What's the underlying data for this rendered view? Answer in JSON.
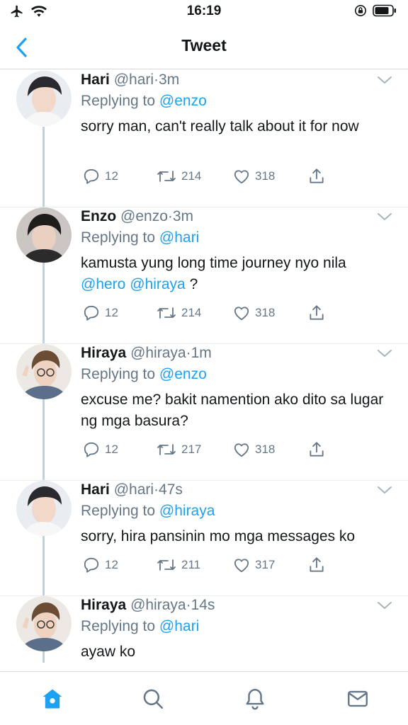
{
  "status_bar": {
    "time": "16:19"
  },
  "nav": {
    "title": "Tweet"
  },
  "colors": {
    "accent": "#1da1f2",
    "secondary_text": "#657786",
    "primary_text": "#14171a"
  },
  "tweets": [
    {
      "name": "Hari",
      "handle": "@hari",
      "dot": "·",
      "time": "3m",
      "replying_label": "Replying to",
      "replying_to": "@enzo",
      "body": "sorry man, can't really talk about it for now",
      "mentions": "",
      "replies": "12",
      "retweets": "214",
      "likes": "318"
    },
    {
      "name": "Enzo",
      "handle": "@enzo",
      "dot": "·",
      "time": "3m",
      "replying_label": "Replying to",
      "replying_to": "@hari",
      "body": "kamusta yung long time journey nyo nila",
      "mentions": [
        "@hero",
        "@hiraya",
        "?"
      ],
      "replies": "12",
      "retweets": "214",
      "likes": "318"
    },
    {
      "name": "Hiraya",
      "handle": "@hiraya",
      "dot": "·",
      "time": "1m",
      "replying_label": "Replying to",
      "replying_to": "@enzo",
      "body": "excuse me? bakit namention ako dito sa lugar ng mga basura?",
      "mentions": "",
      "replies": "12",
      "retweets": "217",
      "likes": "318"
    },
    {
      "name": "Hari",
      "handle": "@hari",
      "dot": "·",
      "time": "47s",
      "replying_label": "Replying to",
      "replying_to": "@hiraya",
      "body": "sorry, hira pansinin mo mga messages ko",
      "mentions": "",
      "replies": "12",
      "retweets": "211",
      "likes": "317"
    },
    {
      "name": "Hiraya",
      "handle": "@hiraya",
      "dot": "·",
      "time": "14s",
      "replying_label": "Replying to",
      "replying_to": "@hari",
      "body": "ayaw ko",
      "mentions": "",
      "replies": "",
      "retweets": "",
      "likes": ""
    }
  ],
  "tab_bar": {
    "icons": [
      "home-icon",
      "search-icon",
      "notifications-icon",
      "messages-icon"
    ]
  }
}
